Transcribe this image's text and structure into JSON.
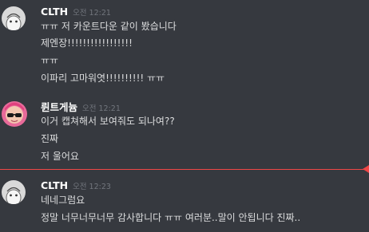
{
  "messages": [
    {
      "author": "CLTH",
      "time": "오전 12:21",
      "lines": [
        "ㅠㅠ 저 카운트다운 같이 봤습니다",
        "제엔장!!!!!!!!!!!!!!!!!",
        "ㅠㅠ",
        "이파리 고마워엿!!!!!!!!!! ㅠㅠ"
      ]
    },
    {
      "author": "륀트게늄",
      "time": "오전 12:21",
      "lines": [
        "이거 캡쳐해서 보여줘도 되나여??",
        "진짜",
        "저 울어요"
      ]
    },
    {
      "author": "CLTH",
      "time": "오전 12:23",
      "lines": [
        "네네그럼요",
        "정말 너무너무너무 감사합니다 ㅠㅠ 여러분..말이 안됩니다 진짜.."
      ]
    }
  ],
  "colors": {
    "background": "#36393f",
    "username": "#ffffff",
    "timestamp": "#72767d",
    "new_messages_divider": "#f04747"
  }
}
